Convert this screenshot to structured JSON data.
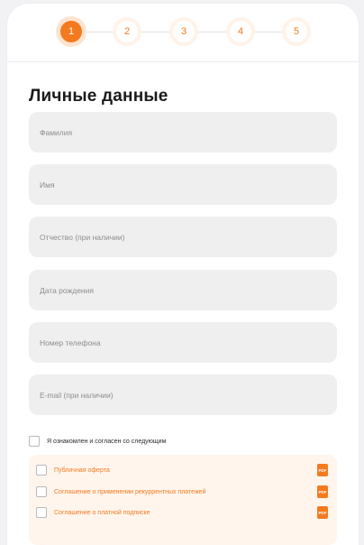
{
  "stepper": {
    "steps": [
      "1",
      "2",
      "3",
      "4",
      "5"
    ],
    "active": 1
  },
  "form": {
    "title": "Личные данные",
    "fields": [
      {
        "placeholder": "Фамилия"
      },
      {
        "placeholder": "Имя"
      },
      {
        "placeholder": "Отчество (при наличии)"
      },
      {
        "placeholder": "Дата рождения"
      },
      {
        "placeholder": "Номер телефона"
      },
      {
        "placeholder": "E-mail (при наличии)"
      }
    ],
    "agree_label": "Я ознакомлен и согласен со следующим",
    "documents": [
      {
        "label": "Публичная оферта",
        "badge": "PDF"
      },
      {
        "label": "Соглашение о применении рекуррентных платежей",
        "badge": "PDF"
      },
      {
        "label": "Соглашение о платной подписке",
        "badge": "PDF"
      }
    ]
  },
  "colors": {
    "accent": "#f47a1f",
    "field_bg": "#efeff0",
    "docs_bg": "#fff5ec"
  }
}
